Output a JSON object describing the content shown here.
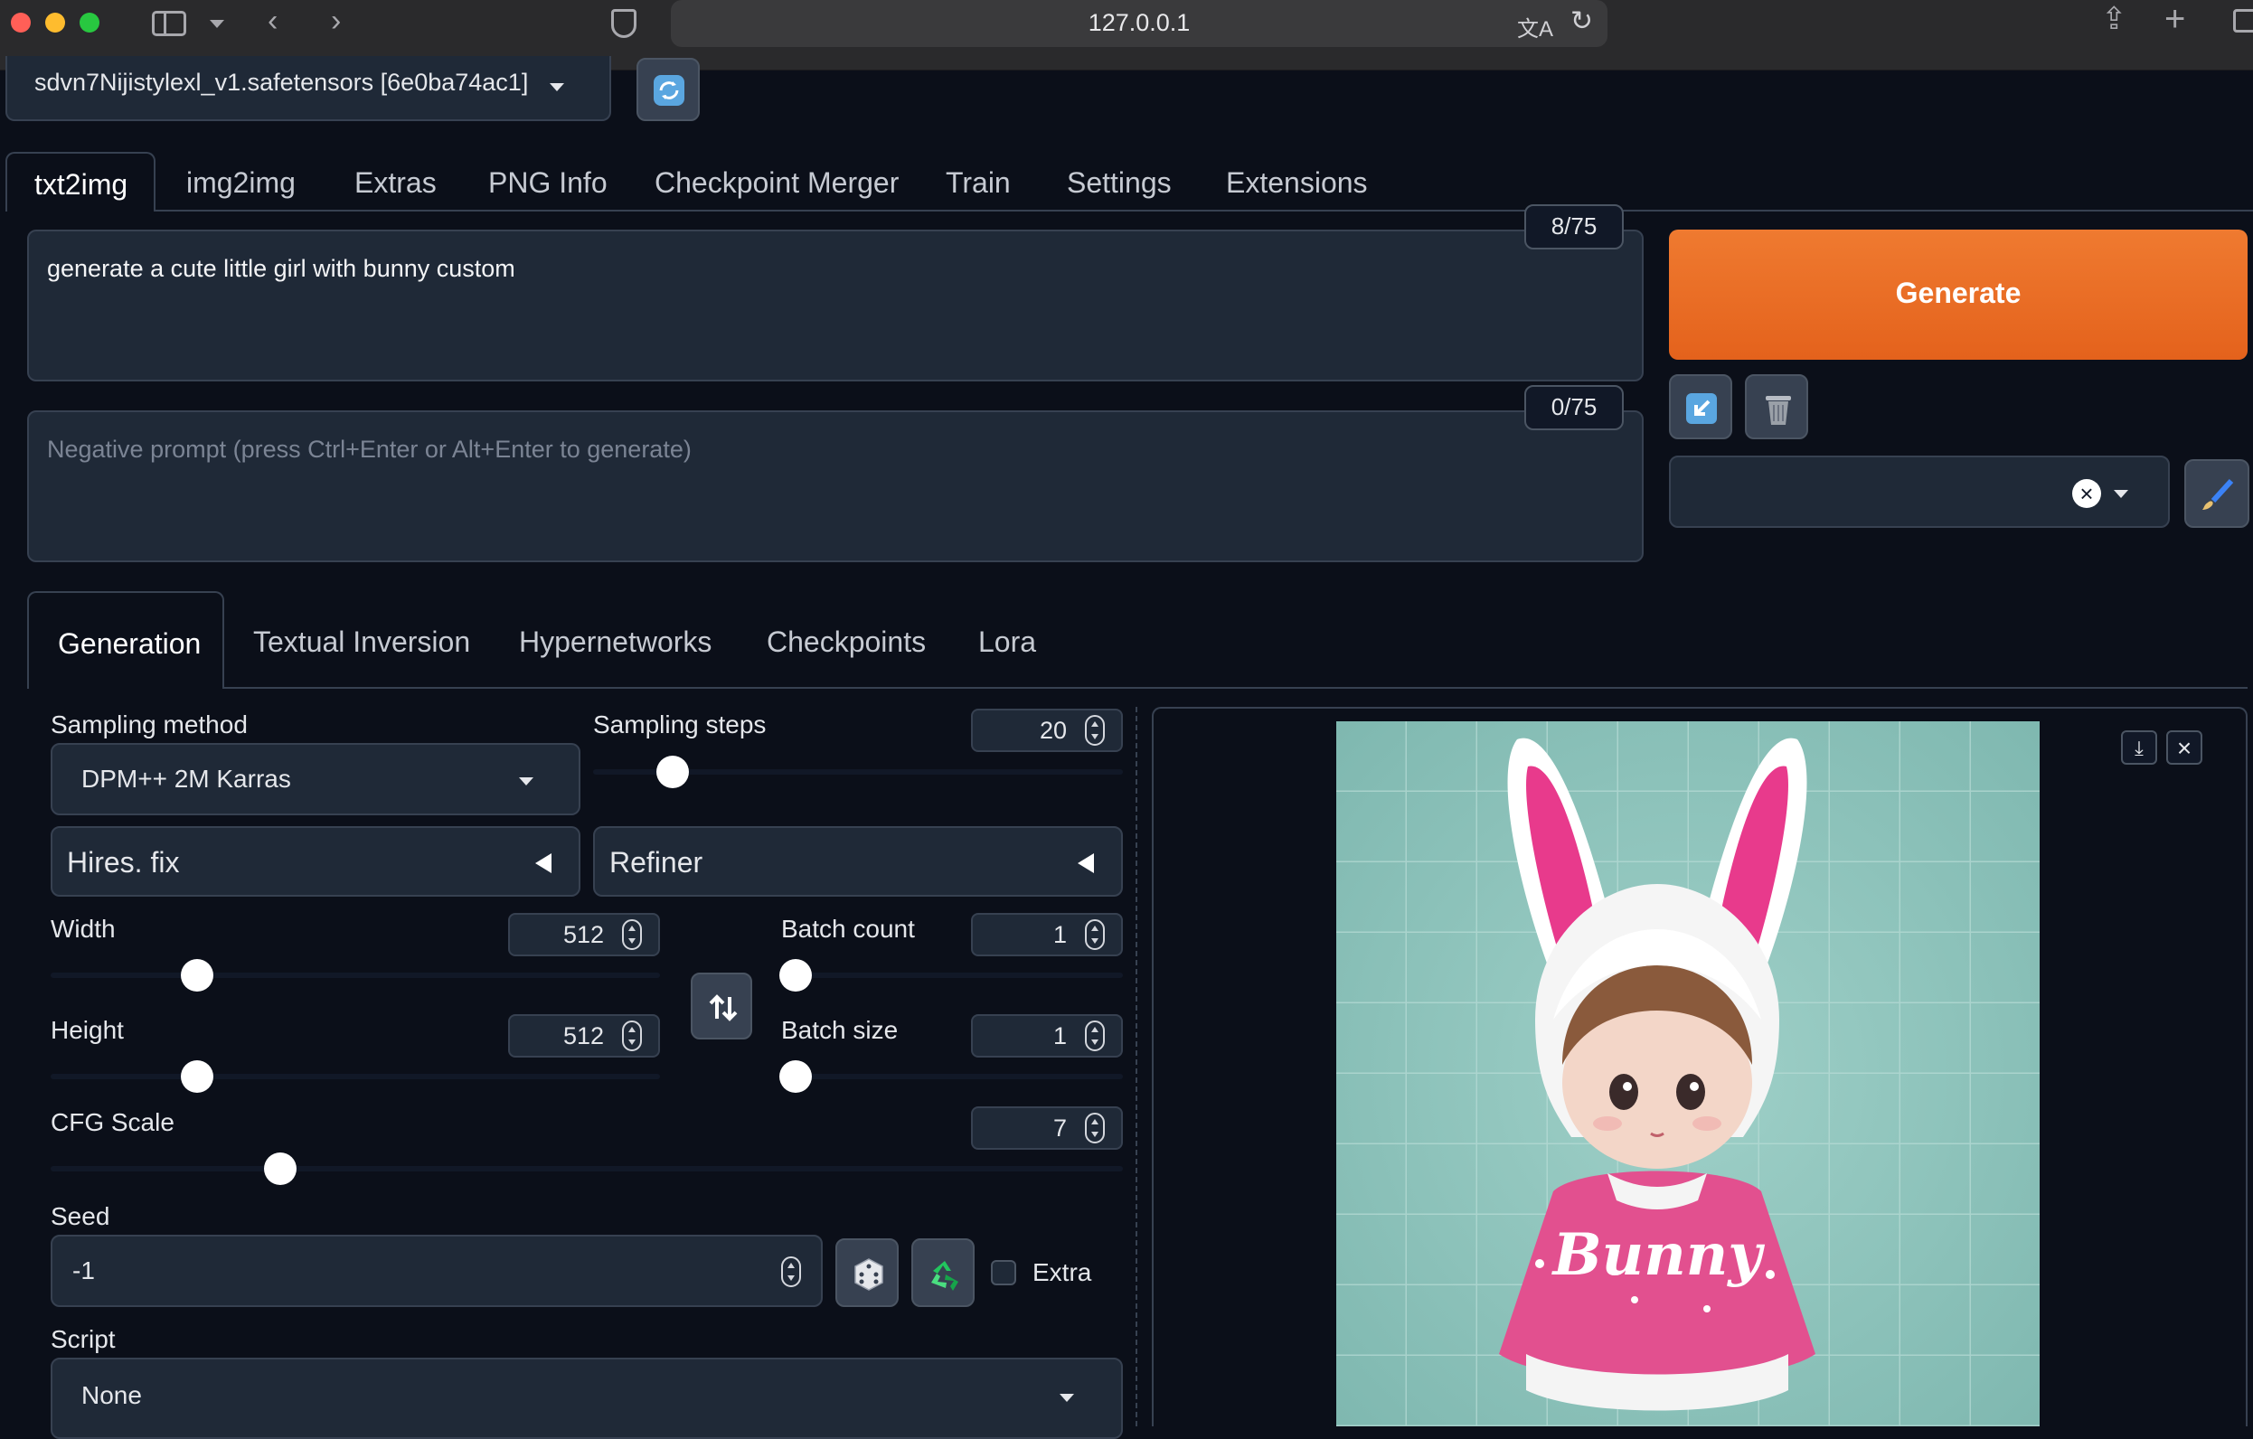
{
  "browser": {
    "url": "127.0.0.1"
  },
  "model": {
    "checkpoint": "sdvn7Nijistylexl_v1.safetensors [6e0ba74ac1]"
  },
  "main_tabs": [
    {
      "label": "txt2img",
      "active": true
    },
    {
      "label": "img2img"
    },
    {
      "label": "Extras"
    },
    {
      "label": "PNG Info"
    },
    {
      "label": "Checkpoint Merger"
    },
    {
      "label": "Train"
    },
    {
      "label": "Settings"
    },
    {
      "label": "Extensions"
    }
  ],
  "prompt": {
    "value": "generate a cute little girl with bunny custom",
    "token_count": "8/75"
  },
  "negative_prompt": {
    "placeholder": "Negative prompt (press Ctrl+Enter or Alt+Enter to generate)",
    "token_count": "0/75"
  },
  "generate": {
    "label": "Generate",
    "color": "#ea6a24"
  },
  "sub_tabs": [
    {
      "label": "Generation",
      "active": true
    },
    {
      "label": "Textual Inversion"
    },
    {
      "label": "Hypernetworks"
    },
    {
      "label": "Checkpoints"
    },
    {
      "label": "Lora"
    }
  ],
  "params": {
    "sampling_method_label": "Sampling method",
    "sampling_method_value": "DPM++ 2M Karras",
    "sampling_steps_label": "Sampling steps",
    "sampling_steps_value": "20",
    "hires_fix_label": "Hires. fix",
    "refiner_label": "Refiner",
    "width_label": "Width",
    "width_value": "512",
    "height_label": "Height",
    "height_value": "512",
    "batch_count_label": "Batch count",
    "batch_count_value": "1",
    "batch_size_label": "Batch size",
    "batch_size_value": "1",
    "cfg_label": "CFG Scale",
    "cfg_value": "7",
    "seed_label": "Seed",
    "seed_value": "-1",
    "extra_label": "Extra",
    "script_label": "Script",
    "script_value": "None"
  },
  "output": {
    "image_text": "Bunny"
  },
  "icons": {
    "refresh": "refresh-icon",
    "paste": "arrow-icon",
    "trash": "trash-icon",
    "edit": "paintbrush-icon",
    "swap": "swap-vertical-icon",
    "dice": "dice-icon",
    "recycle": "recycle-icon",
    "download": "download-icon",
    "close": "close-icon"
  }
}
